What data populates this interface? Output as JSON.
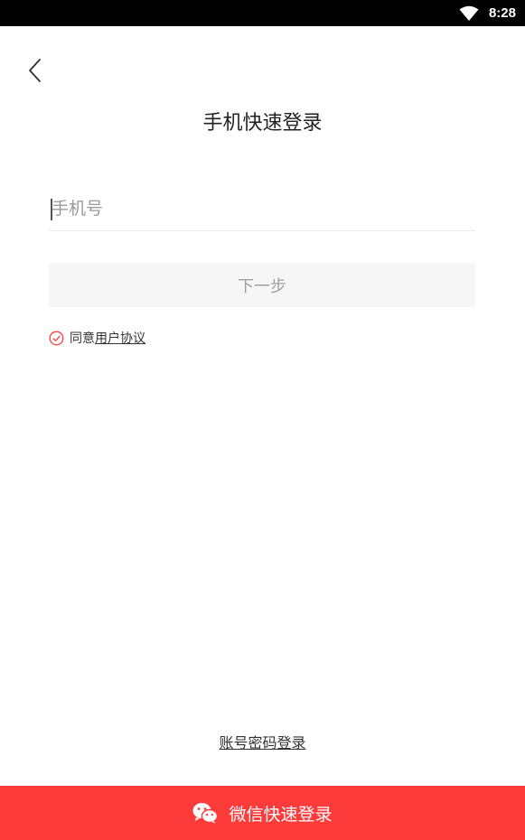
{
  "status_bar": {
    "time": "8:28",
    "wifi_icon": "wifi-icon"
  },
  "header": {
    "back_icon": "chevron-left-icon",
    "title": "手机快速登录"
  },
  "form": {
    "phone_placeholder": "手机号",
    "phone_value": "",
    "next_label": "下一步"
  },
  "agreement": {
    "check_icon": "check-circle-icon",
    "prefix": "同意",
    "link": "用户协议",
    "accent_color": "#fe3b3b"
  },
  "footer": {
    "account_login_label": "账号密码登录",
    "wechat_icon": "wechat-icon",
    "wechat_login_label": "微信快速登录",
    "wechat_button_color": "#fe3b3b"
  }
}
